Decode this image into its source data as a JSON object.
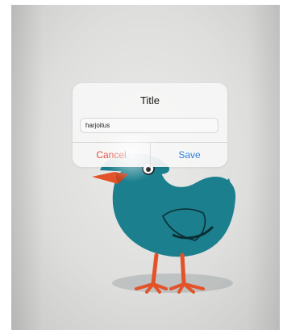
{
  "alert": {
    "title": "Title",
    "input_value": "harjoitus",
    "cancel_label": "Cancel",
    "save_label": "Save"
  },
  "colors": {
    "bird_body": "#1b7f8e",
    "bird_dark": "#105a66",
    "beak_and_legs": "#e2532a",
    "cancel": "#e14b3d",
    "save": "#2f7fe0"
  }
}
